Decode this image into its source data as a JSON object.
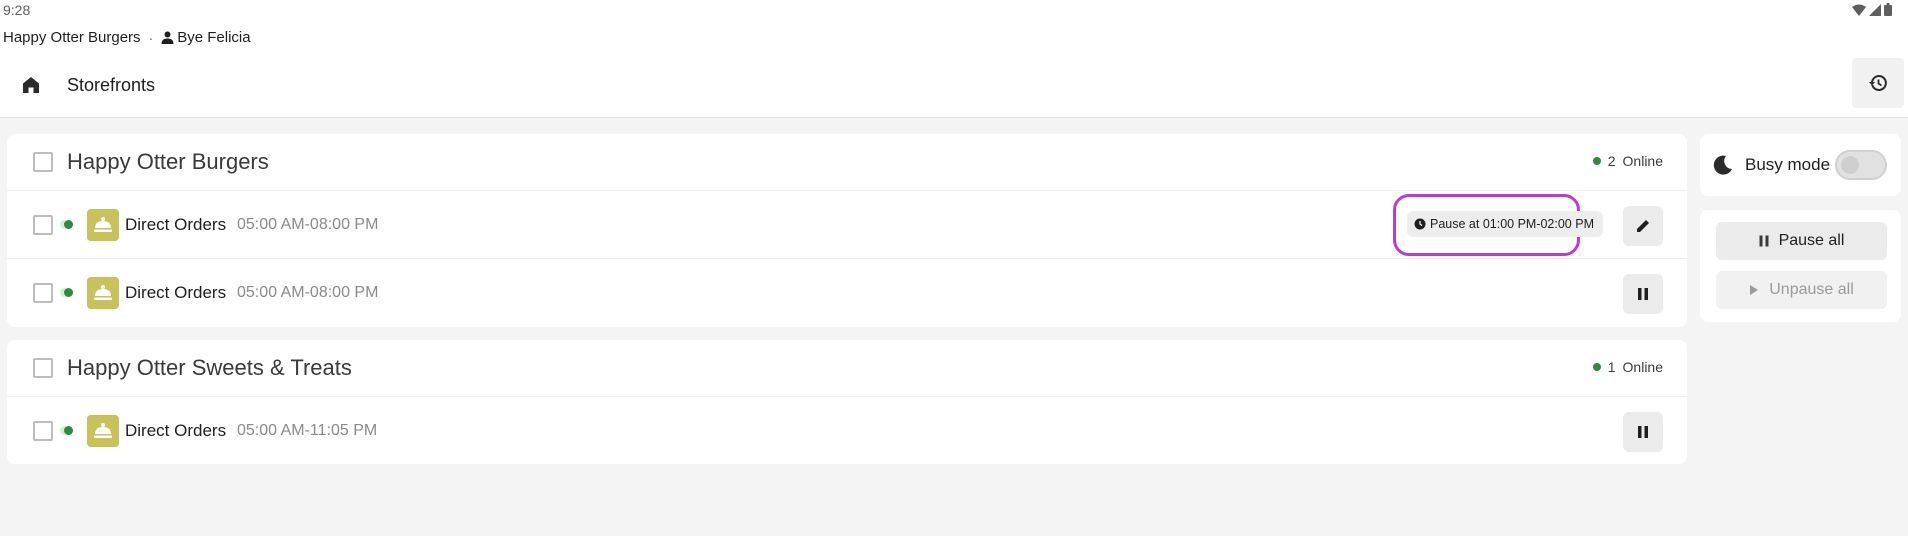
{
  "status_bar": {
    "time": "9:28"
  },
  "account": {
    "business_name": "Happy Otter Burgers",
    "separator": "·",
    "user_name": "Bye Felicia"
  },
  "toolbar": {
    "title": "Storefronts"
  },
  "groups": [
    {
      "title": "Happy Otter Burgers",
      "online_count": "2",
      "online_label": "Online",
      "rows": [
        {
          "name": "Direct Orders",
          "hours": "05:00 AM-08:00 PM",
          "pause_chip": "Pause at 01:00 PM-02:00 PM",
          "action_icon": "pencil-icon"
        },
        {
          "name": "Direct Orders",
          "hours": "05:00 AM-08:00 PM",
          "action_icon": "pause-icon"
        }
      ]
    },
    {
      "title": "Happy Otter Sweets & Treats",
      "online_count": "1",
      "online_label": "Online",
      "rows": [
        {
          "name": "Direct Orders",
          "hours": "05:00 AM-11:05 PM",
          "action_icon": "pause-icon"
        }
      ]
    }
  ],
  "panel": {
    "busy_mode_label": "Busy mode",
    "busy_mode_on": false,
    "pause_all_label": "Pause all",
    "unpause_all_label": "Unpause all"
  },
  "colors": {
    "online": "#2e8b3e",
    "highlight": "#b73ed3",
    "store_icon_bg": "#c9c25a"
  }
}
